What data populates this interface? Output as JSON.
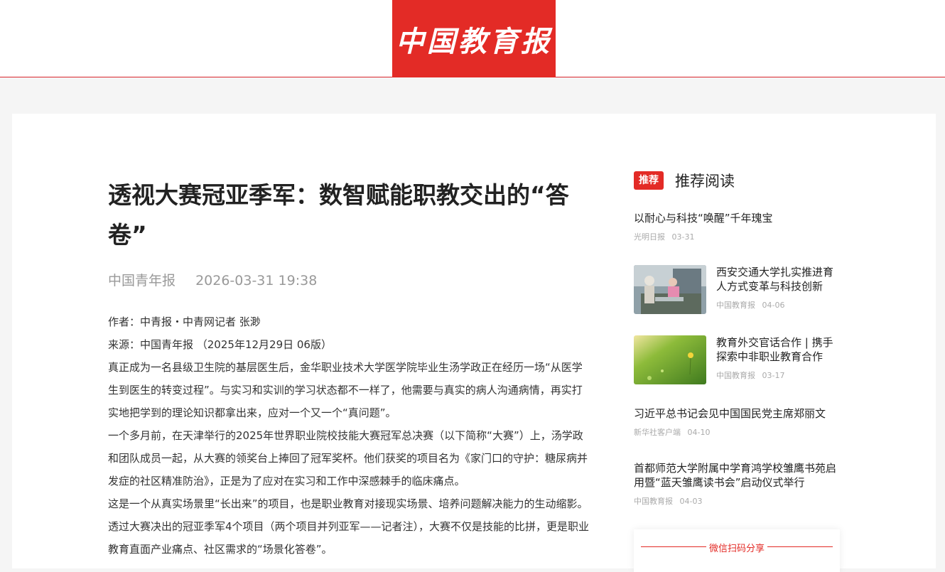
{
  "header": {
    "logo_text": "中国教育报",
    "brand_color": "#e32b26"
  },
  "article": {
    "title": "透视大赛冠亚季军：数智赋能职教交出的“答卷”",
    "source": "中国青年报",
    "datetime": "2026-03-31 19:38",
    "author_line": "作者：中青报・中青网记者 张渺",
    "source_line": "来源：中国青年报 （2025年12月29日 06版）",
    "paragraphs": [
      "真正成为一名县级卫生院的基层医生后，金华职业技术大学医学院毕业生汤学政正在经历一场“从医学生到医生的转变过程”。与实习和实训的学习状态都不一样了，他需要与真实的病人沟通病情，再实打实地把学到的理论知识都拿出来，应对一个又一个“真问题”。",
      "一个多月前，在天津举行的2025年世界职业院校技能大赛冠军总决赛（以下简称“大赛”）上，汤学政和团队成员一起，从大赛的领奖台上捧回了冠军奖杯。他们获奖的项目名为《家门口的守护：糖尿病并发症的社区精准防治》，正是为了应对在实习和工作中深感棘手的临床痛点。",
      "这是一个从真实场景里“长出来”的项目，也是职业教育对接现实场景、培养问题解决能力的生动缩影。透过大赛决出的冠亚季军4个项目（两个项目并列亚军——记者注），大赛不仅是技能的比拼，更是职业教育直面产业痛点、社区需求的“场景化答卷”。"
    ]
  },
  "sidebar": {
    "tag": "推荐",
    "title": "推荐阅读",
    "items": [
      {
        "title": "以耐心与科技“唤醒”千年瑰宝",
        "source": "光明日报",
        "date": "03-31"
      },
      {
        "title": "西安交通大学扎实推进育人方式变革与科技创新",
        "source": "中国教育报",
        "date": "04-06",
        "thumb": "lab-photo"
      },
      {
        "title": "教育外交官话合作 | 携手探索中非职业教育合作",
        "source": "中国教育报",
        "date": "03-17",
        "thumb": "grass-photo"
      },
      {
        "title": "习近平总书记会见中国国民党主席郑丽文",
        "source": "新华社客户端",
        "date": "04-10"
      },
      {
        "title": "首都师范大学附属中学育鸿学校雏鹰书苑启用暨“蓝天雏鹰读书会”启动仪式举行",
        "source": "中国教育报",
        "date": "04-03"
      }
    ],
    "share_label": "微信扫码分享"
  }
}
